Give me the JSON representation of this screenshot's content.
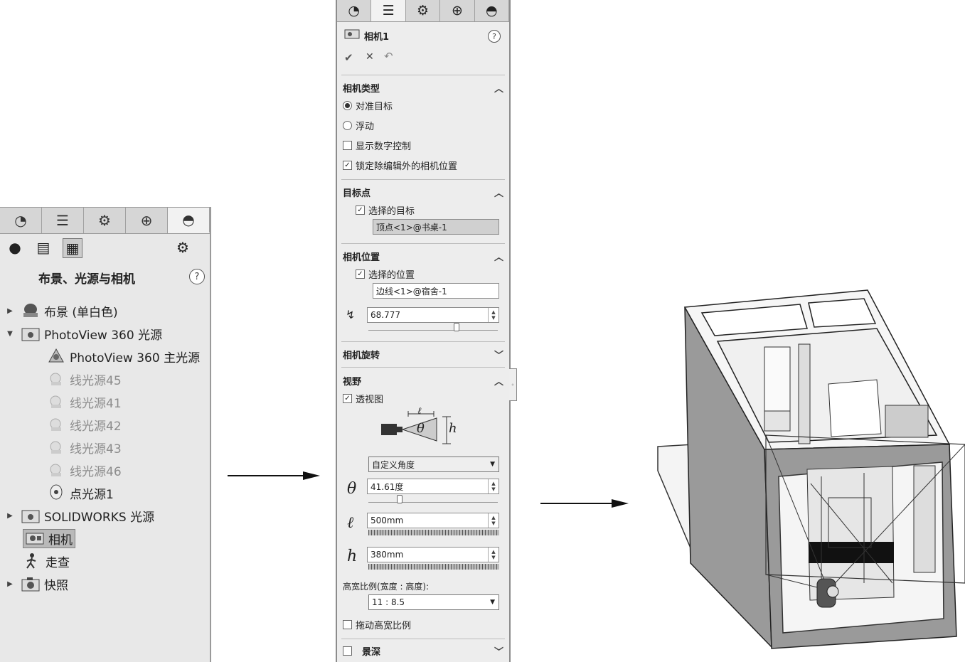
{
  "left_panel": {
    "title": "布景、光源与相机",
    "help": "?",
    "tree": [
      {
        "label": "布景 (单白色)",
        "dim": false
      },
      {
        "label": "PhotoView 360 光源",
        "dim": false
      },
      {
        "label": "PhotoView 360 主光源",
        "dim": false
      },
      {
        "label": "线光源45",
        "dim": true
      },
      {
        "label": "线光源41",
        "dim": true
      },
      {
        "label": "线光源42",
        "dim": true
      },
      {
        "label": "线光源43",
        "dim": true
      },
      {
        "label": "线光源46",
        "dim": true
      },
      {
        "label": "点光源1",
        "dim": false
      },
      {
        "label": "SOLIDWORKS 光源",
        "dim": false
      },
      {
        "label": "相机",
        "dim": false
      },
      {
        "label": "走查",
        "dim": false
      },
      {
        "label": "快照",
        "dim": false
      }
    ]
  },
  "mid_panel": {
    "title": "相机1",
    "help": "?",
    "ok": "✔",
    "cancel": "✕",
    "sections": {
      "camera_type": {
        "header": "相机类型",
        "options": [
          "对准目标",
          "浮动"
        ],
        "checkboxes": [
          "显示数字控制",
          "锁定除编辑外的相机位置"
        ]
      },
      "target": {
        "header": "目标点",
        "checkbox": "选择的目标",
        "value": "顶点<1>@书桌-1"
      },
      "position": {
        "header": "相机位置",
        "checkbox": "选择的位置",
        "value": "边线<1>@宿舍-1",
        "distance": "68.777"
      },
      "rotation": {
        "header": "相机旋转"
      },
      "fov": {
        "header": "视野",
        "checkbox": "透视图",
        "diagram_l": "ℓ",
        "diagram_theta": "θ",
        "diagram_h": "h",
        "preset": "自定义角度",
        "theta_sym": "θ",
        "theta": "41.61度",
        "l_sym": "ℓ",
        "l": "500mm",
        "h_sym": "h",
        "h": "380mm",
        "ratio_label": "高宽比例(宽度 : 高度):",
        "ratio": "11 : 8.5",
        "drag_ratio": "拖动高宽比例"
      },
      "dof": {
        "header": "景深"
      }
    }
  }
}
